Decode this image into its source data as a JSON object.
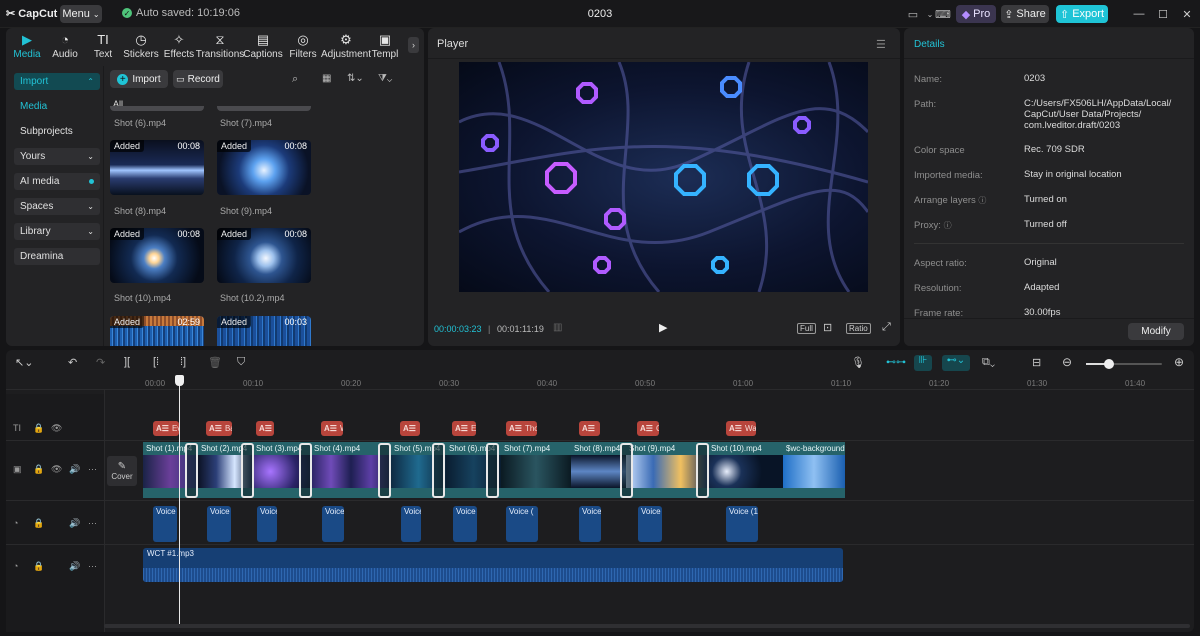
{
  "app": {
    "name": "CapCut",
    "menu_label": "Menu",
    "autosave": "Auto saved: 10:19:06",
    "project_title": "0203"
  },
  "topbar": {
    "pro_label": "Pro",
    "share_label": "Share",
    "export_label": "Export",
    "accent": "#1fc4d6"
  },
  "tools": [
    {
      "label": "Media",
      "icon": "media-icon"
    },
    {
      "label": "Audio",
      "icon": "audio-icon"
    },
    {
      "label": "Text",
      "icon": "text-icon"
    },
    {
      "label": "Stickers",
      "icon": "stickers-icon"
    },
    {
      "label": "Effects",
      "icon": "effects-icon"
    },
    {
      "label": "Transitions",
      "icon": "transitions-icon"
    },
    {
      "label": "Captions",
      "icon": "captions-icon"
    },
    {
      "label": "Filters",
      "icon": "filters-icon"
    },
    {
      "label": "Adjustment",
      "icon": "adjustment-icon"
    },
    {
      "label": "Templ",
      "icon": "templates-icon"
    }
  ],
  "sidebar": {
    "import_label": "Import",
    "media_label": "Media",
    "subprojects_label": "Subprojects",
    "yours_label": "Yours",
    "ai_media_label": "AI media",
    "spaces_label": "Spaces",
    "library_label": "Library",
    "dreamina_label": "Dreamina"
  },
  "media": {
    "import_button": "Import",
    "record_button": "Record",
    "filter_all": "All",
    "top_labels": [
      "Shot (6).mp4",
      "Shot (7).mp4"
    ],
    "items": [
      {
        "name": "Shot (8).mp4",
        "badge": "Added",
        "duration": "00:08"
      },
      {
        "name": "Shot (9).mp4",
        "badge": "Added",
        "duration": "00:08"
      },
      {
        "name": "Shot (10).mp4",
        "badge": "Added",
        "duration": "00:08"
      },
      {
        "name": "Shot (10.2).mp4",
        "badge": "Added",
        "duration": "00:08"
      },
      {
        "name": "",
        "badge": "Added",
        "duration": "02:59"
      },
      {
        "name": "",
        "badge": "Added",
        "duration": "00:03"
      }
    ]
  },
  "player": {
    "title": "Player",
    "current_time": "00:00:03:23",
    "total_time": "00:01:11:19",
    "full_label": "Full",
    "ratio_label": "Ratio"
  },
  "details": {
    "title": "Details",
    "rows": [
      {
        "key": "Name:",
        "value": "0203"
      },
      {
        "key": "Path:",
        "value": "C:/Users/FX506LH/AppData/Local/ CapCut/User Data/Projects/ com.lveditor.draft/0203"
      },
      {
        "key": "Color space",
        "value": "Rec. 709 SDR"
      },
      {
        "key": "Imported media:",
        "value": "Stay in original location"
      },
      {
        "key": "Arrange layers",
        "value": "Turned on"
      },
      {
        "key": "Proxy:",
        "value": "Turned off"
      },
      {
        "key": "Aspect ratio:",
        "value": "Original"
      },
      {
        "key": "Resolution:",
        "value": "Adapted"
      },
      {
        "key": "Frame rate:",
        "value": "30.00fps"
      }
    ],
    "modify_button": "Modify"
  },
  "timeline": {
    "ruler": [
      "00:00",
      "00:10",
      "00:20",
      "00:30",
      "00:40",
      "00:50",
      "01:00",
      "01:10",
      "01:20",
      "01:30",
      "01:40"
    ],
    "cover_label": "Cover",
    "text_clips": [
      "Ev",
      "Ba",
      "",
      "W",
      "",
      "Ev",
      "Tho",
      "",
      "C",
      "Wal"
    ],
    "video_clips": [
      "Shot (1).mp4",
      "Shot (2).mp4",
      "Shot (3).mp4",
      "Shot (4).mp4",
      "Shot (5).mp4",
      "Shot (6).mp4",
      "Shot (7).mp4",
      "Shot (8).mp4",
      "Shot (9).mp4",
      "Shot (10).mp4",
      "$wc-background"
    ],
    "voice_clips": [
      "Voice",
      "Voice",
      "Voice",
      "Voice",
      "Voice",
      "Voice",
      "Voice (",
      "Voice",
      "Voice",
      "Voice (1"
    ],
    "music_clip": "WCT #1.mp3"
  }
}
